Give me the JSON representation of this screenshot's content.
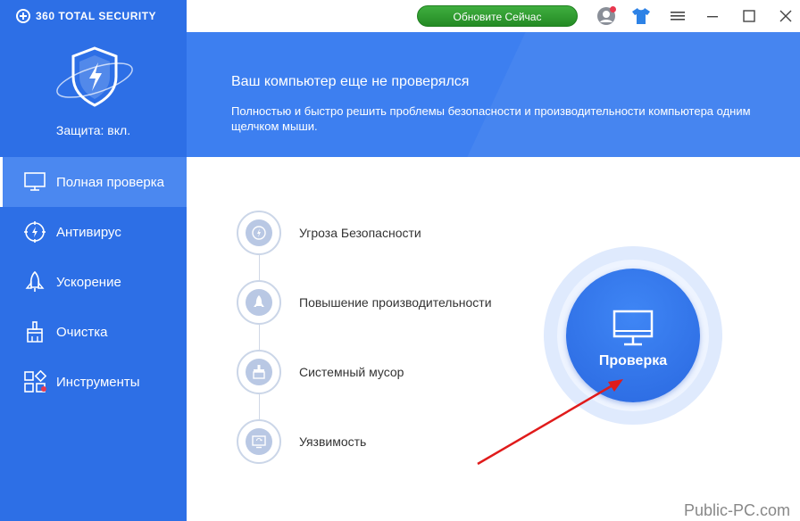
{
  "app": {
    "brand": "360 TOTAL SECURITY",
    "protection_status": "Защита: вкл."
  },
  "titlebar": {
    "update_button": "Обновите Сейчас",
    "icons": [
      "user-avatar-icon",
      "tshirt-skin-icon",
      "menu-icon",
      "minimize-icon",
      "maximize-icon",
      "close-icon"
    ]
  },
  "nav": {
    "items": [
      {
        "label": "Полная проверка",
        "icon": "monitor-icon",
        "active": true
      },
      {
        "label": "Антивирус",
        "icon": "antivirus-icon",
        "active": false
      },
      {
        "label": "Ускорение",
        "icon": "rocket-icon",
        "active": false
      },
      {
        "label": "Очистка",
        "icon": "broom-icon",
        "active": false
      },
      {
        "label": "Инструменты",
        "icon": "tools-grid-icon",
        "active": false
      }
    ]
  },
  "banner": {
    "title": "Ваш компьютер еще не проверялся",
    "description": "Полностью и быстро решить проблемы безопасности и производительности компьютера одним щелчком мыши."
  },
  "checklist": {
    "items": [
      {
        "label": "Угроза Безопасности",
        "icon": "threat-icon"
      },
      {
        "label": "Повышение производительности",
        "icon": "rocket-icon"
      },
      {
        "label": "Системный мусор",
        "icon": "broom-icon"
      },
      {
        "label": "Уязвимость",
        "icon": "vulnerability-icon"
      }
    ]
  },
  "scan": {
    "label": "Проверка"
  },
  "watermark": "Public-PC.com",
  "colors": {
    "sidebar": "#2d6fe6",
    "sidebar_active": "#4b88f0",
    "banner": "#3d7ff0",
    "update_button": "#2e9b2e",
    "scan_button": "#2f72e8",
    "arrow": "#e01b1b"
  }
}
